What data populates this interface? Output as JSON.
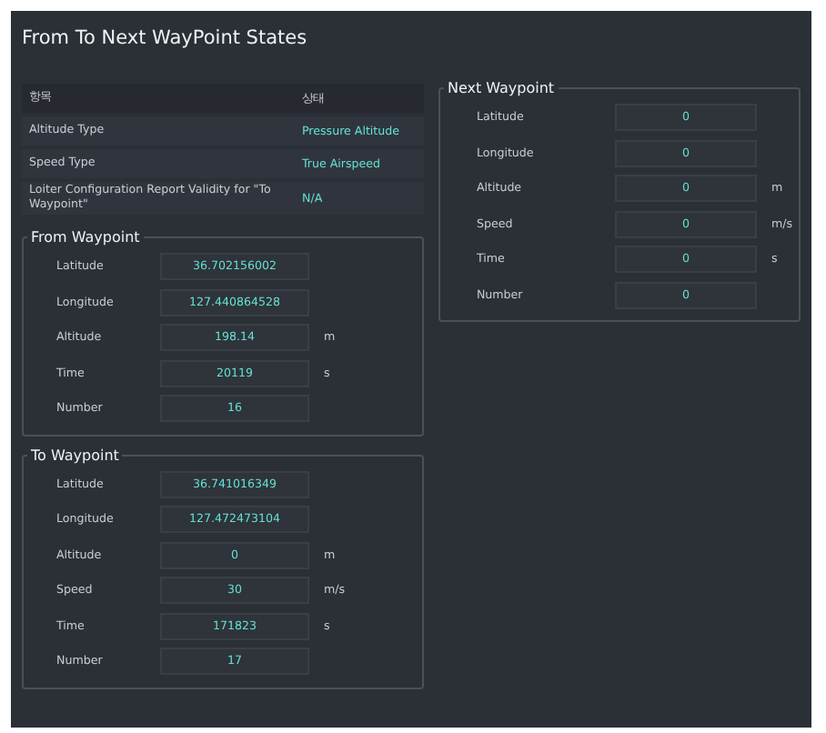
{
  "window": {
    "title": "From To Next WayPoint States"
  },
  "table": {
    "columns": [
      "항목",
      "상태"
    ],
    "rows": [
      {
        "label": "Altitude Type",
        "value": "Pressure Altitude"
      },
      {
        "label": "Speed Type",
        "value": "True Airspeed"
      },
      {
        "label": "Loiter Configuration Report Validity for \"To Waypoint\"",
        "value": "N/A"
      }
    ]
  },
  "from_waypoint": {
    "title": "From Waypoint",
    "fields": [
      {
        "label": "Latitude",
        "value": "36.702156002"
      },
      {
        "label": "Longitude",
        "value": "127.440864528"
      },
      {
        "label": "Altitude",
        "value": "198.14",
        "unit": "m"
      },
      {
        "label": "Time",
        "value": "20119",
        "unit": "s"
      },
      {
        "label": "Number",
        "value": "16"
      }
    ]
  },
  "to_waypoint": {
    "title": "To Waypoint",
    "fields": [
      {
        "label": "Latitude",
        "value": "36.741016349"
      },
      {
        "label": "Longitude",
        "value": "127.472473104"
      },
      {
        "label": "Altitude",
        "value": "0",
        "unit": "m"
      },
      {
        "label": "Speed",
        "value": "30",
        "unit": "m/s"
      },
      {
        "label": "Time",
        "value": "171823",
        "unit": "s"
      },
      {
        "label": "Number",
        "value": "17"
      }
    ]
  },
  "next_waypoint": {
    "title": "Next Waypoint",
    "fields": [
      {
        "label": "Latitude",
        "value": "0"
      },
      {
        "label": "Longitude",
        "value": "0"
      },
      {
        "label": "Altitude",
        "value": "0",
        "unit": "m"
      },
      {
        "label": "Speed",
        "value": "0",
        "unit": "m/s"
      },
      {
        "label": "Time",
        "value": "0",
        "unit": "s"
      },
      {
        "label": "Number",
        "value": "0"
      }
    ]
  }
}
